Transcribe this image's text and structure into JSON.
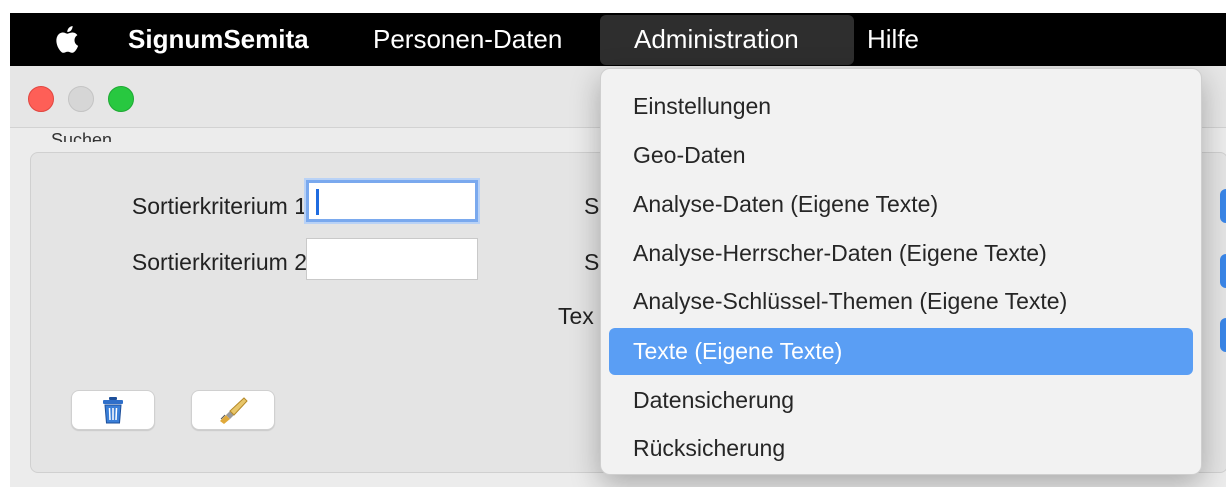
{
  "menubar": {
    "apple_icon": "apple-icon",
    "app_name": "SignumSemita",
    "items": [
      "Personen-Daten",
      "Administration",
      "Hilfe"
    ]
  },
  "window": {
    "group_label": "Suchen",
    "fields": [
      {
        "label": "Sortierkriterium 1",
        "value": ""
      },
      {
        "label": "Sortierkriterium 2",
        "value": ""
      }
    ],
    "partial_labels": [
      "S",
      "S",
      "Tex"
    ],
    "buttons": [
      {
        "icon": "trash-icon"
      },
      {
        "icon": "brush-icon"
      }
    ]
  },
  "dropdown": {
    "items": [
      "Einstellungen",
      "Geo-Daten",
      "Analyse-Daten (Eigene Texte)",
      "Analyse-Herrscher-Daten (Eigene Texte)",
      "Analyse-Schlüssel-Themen (Eigene Texte)",
      "Texte (Eigene Texte)",
      "Datensicherung",
      "Rücksicherung"
    ],
    "selected_index": 5
  },
  "colors": {
    "menubar": "#000000",
    "selection": "#5a9ef4",
    "close": "#fe5f57",
    "maximize": "#28c840"
  }
}
